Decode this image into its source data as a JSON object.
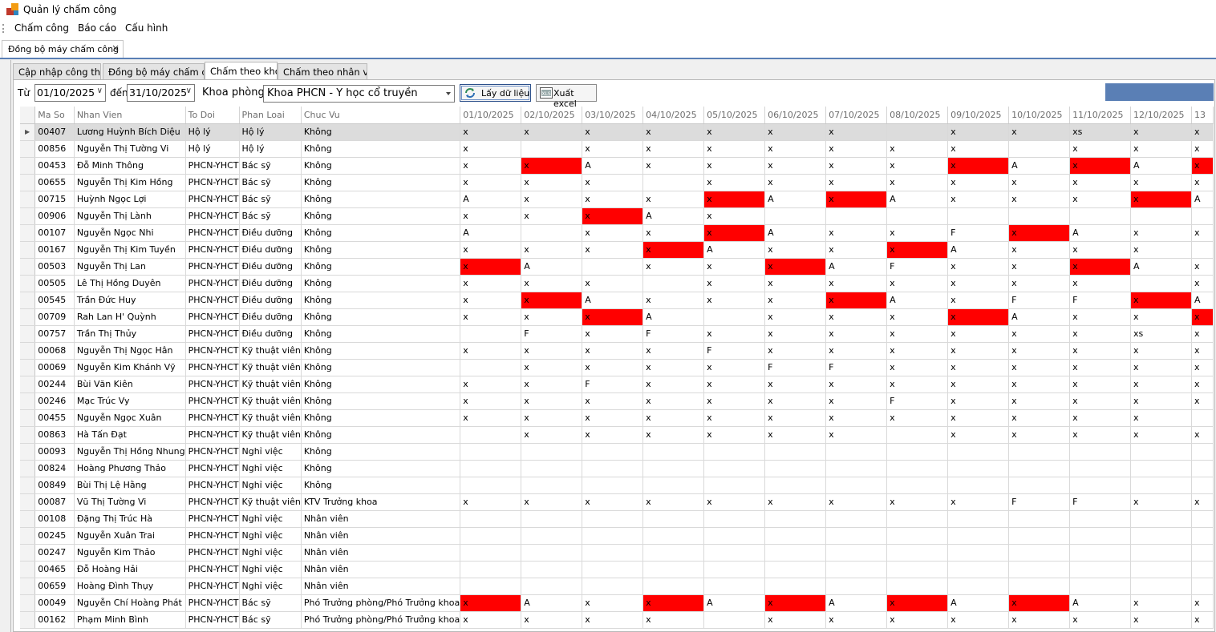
{
  "window": {
    "title": "Quản lý chấm công"
  },
  "menu": [
    "Chấm công",
    "Báo cáo",
    "Cấu hình"
  ],
  "doc_tab": {
    "label": "Đồng bộ máy chấm công",
    "close": "×"
  },
  "sub_tabs": [
    "Cập nhập công thức",
    "Đồng bộ máy chấm công",
    "Chấm theo khoa",
    "Chấm theo nhân viên"
  ],
  "filters": {
    "from_label": "Từ",
    "from_value": "01/10/2025",
    "to_label": "đến",
    "to_value": "31/10/2025",
    "dept_label": "Khoa phòng",
    "dept_value": "Khoa PHCN - Y học cổ truyền",
    "fetch_button": "Lấy dữ liệu",
    "export_button": "Xuất excel"
  },
  "colors": {
    "absent_highlight": "#ff0000",
    "accent": "#5a7fb5"
  },
  "grid": {
    "columns": [
      "Ma So",
      "Nhan Vien",
      "To Doi",
      "Phan Loai",
      "Chuc Vu",
      "01/10/2025",
      "02/10/2025",
      "03/10/2025",
      "04/10/2025",
      "05/10/2025",
      "06/10/2025",
      "07/10/2025",
      "08/10/2025",
      "09/10/2025",
      "10/10/2025",
      "11/10/2025",
      "12/10/2025",
      "13"
    ],
    "rows": [
      {
        "id": "00407",
        "name": "Lương Huỳnh Bích Diệu",
        "team": "Hộ lý",
        "type": "Hộ lý",
        "role": "Không",
        "days": [
          "x",
          "x",
          "x",
          "x",
          "x",
          "x",
          "x",
          "",
          "x",
          "x",
          "xs",
          "x",
          "x"
        ],
        "red": []
      },
      {
        "id": "00856",
        "name": "Nguyễn Thị Tường Vi",
        "team": "Hộ lý",
        "type": "Hộ lý",
        "role": "Không",
        "days": [
          "x",
          "",
          "x",
          "x",
          "x",
          "x",
          "x",
          "x",
          "x",
          "",
          "x",
          "x",
          "x"
        ],
        "red": []
      },
      {
        "id": "00453",
        "name": "Đỗ Minh Thông",
        "team": "PHCN-YHCT",
        "type": "Bác sỹ",
        "role": "Không",
        "days": [
          "x",
          "x",
          "A",
          "x",
          "x",
          "x",
          "x",
          "x",
          "x",
          "A",
          "x",
          "A",
          "x"
        ],
        "red": [
          1,
          8,
          10,
          12
        ]
      },
      {
        "id": "00655",
        "name": "Nguyễn Thị Kim Hồng",
        "team": "PHCN-YHCT",
        "type": "Bác sỹ",
        "role": "Không",
        "days": [
          "x",
          "x",
          "x",
          "",
          "x",
          "x",
          "x",
          "x",
          "x",
          "x",
          "x",
          "x",
          "x"
        ],
        "red": []
      },
      {
        "id": "00715",
        "name": "Huỳnh Ngọc Lợi",
        "team": "PHCN-YHCT",
        "type": "Bác sỹ",
        "role": "Không",
        "days": [
          "A",
          "x",
          "x",
          "x",
          "x",
          "A",
          "x",
          "A",
          "x",
          "x",
          "x",
          "x",
          "A"
        ],
        "red": [
          4,
          6,
          11
        ]
      },
      {
        "id": "00906",
        "name": "Nguyễn Thị Lành",
        "team": "PHCN-YHCT",
        "type": "Bác sỹ",
        "role": "Không",
        "days": [
          "x",
          "x",
          "x",
          "A",
          "x",
          "",
          "",
          "",
          "",
          "",
          "",
          "",
          ""
        ],
        "red": [
          2
        ]
      },
      {
        "id": "00107",
        "name": "Nguyễn Ngọc Nhi",
        "team": "PHCN-YHCT",
        "type": "Điều dưỡng",
        "role": "Không",
        "days": [
          "A",
          "",
          "x",
          "x",
          "x",
          "A",
          "x",
          "x",
          "F",
          "x",
          "A",
          "x",
          "x"
        ],
        "red": [
          4,
          9
        ]
      },
      {
        "id": "00167",
        "name": "Nguyễn Thị Kim Tuyền",
        "team": "PHCN-YHCT",
        "type": "Điều dưỡng",
        "role": "Không",
        "days": [
          "x",
          "x",
          "x",
          "x",
          "A",
          "x",
          "x",
          "x",
          "A",
          "x",
          "x",
          "x",
          ""
        ],
        "red": [
          3,
          7
        ]
      },
      {
        "id": "00503",
        "name": "Nguyễn Thị Lan",
        "team": "PHCN-YHCT",
        "type": "Điều dưỡng",
        "role": "Không",
        "days": [
          "x",
          "A",
          "",
          "x",
          "x",
          "x",
          "A",
          "F",
          "x",
          "x",
          "x",
          "A",
          "x"
        ],
        "red": [
          0,
          5,
          10
        ]
      },
      {
        "id": "00505",
        "name": "Lê Thị Hồng Duyên",
        "team": "PHCN-YHCT",
        "type": "Điều dưỡng",
        "role": "Không",
        "days": [
          "x",
          "x",
          "x",
          "",
          "x",
          "x",
          "x",
          "x",
          "x",
          "x",
          "x",
          "",
          "x"
        ],
        "red": []
      },
      {
        "id": "00545",
        "name": "Trần Đức Huy",
        "team": "PHCN-YHCT",
        "type": "Điều dưỡng",
        "role": "Không",
        "days": [
          "x",
          "x",
          "A",
          "x",
          "x",
          "x",
          "x",
          "A",
          "x",
          "F",
          "F",
          "x",
          "A"
        ],
        "red": [
          1,
          6,
          11
        ]
      },
      {
        "id": "00709",
        "name": "Rah Lan H' Quỳnh",
        "team": "PHCN-YHCT",
        "type": "Điều dưỡng",
        "role": "Không",
        "days": [
          "x",
          "x",
          "x",
          "A",
          "",
          "x",
          "x",
          "x",
          "x",
          "A",
          "x",
          "x",
          "x"
        ],
        "red": [
          2,
          8,
          12
        ]
      },
      {
        "id": "00757",
        "name": "Trần Thị Thủy",
        "team": "PHCN-YHCT",
        "type": "Điều dưỡng",
        "role": "Không",
        "days": [
          "",
          "F",
          "x",
          "F",
          "x",
          "x",
          "x",
          "x",
          "x",
          "x",
          "x",
          "xs",
          "x"
        ],
        "red": []
      },
      {
        "id": "00068",
        "name": "Nguyễn Thị Ngọc Hân",
        "team": "PHCN-YHCT",
        "type": "Kỹ thuật viên",
        "role": "Không",
        "days": [
          "x",
          "x",
          "x",
          "x",
          "F",
          "x",
          "x",
          "x",
          "x",
          "x",
          "x",
          "x",
          "x"
        ],
        "red": []
      },
      {
        "id": "00069",
        "name": "Nguyễn Kim Khánh Vỹ",
        "team": "PHCN-YHCT",
        "type": "Kỹ thuật viên",
        "role": "Không",
        "days": [
          "",
          "x",
          "x",
          "x",
          "x",
          "F",
          "F",
          "x",
          "x",
          "x",
          "x",
          "x",
          "x"
        ],
        "red": []
      },
      {
        "id": "00244",
        "name": "Bùi Văn Kiên",
        "team": "PHCN-YHCT",
        "type": "Kỹ thuật viên",
        "role": "Không",
        "days": [
          "x",
          "x",
          "F",
          "x",
          "x",
          "x",
          "x",
          "x",
          "x",
          "x",
          "x",
          "x",
          "x"
        ],
        "red": []
      },
      {
        "id": "00246",
        "name": "Mạc Trúc Vy",
        "team": "PHCN-YHCT",
        "type": "Kỹ thuật viên",
        "role": "Không",
        "days": [
          "x",
          "x",
          "x",
          "x",
          "x",
          "x",
          "x",
          "F",
          "x",
          "x",
          "x",
          "x",
          "x"
        ],
        "red": []
      },
      {
        "id": "00455",
        "name": "Nguyễn Ngọc Xuân",
        "team": "PHCN-YHCT",
        "type": "Kỹ thuật viên",
        "role": "Không",
        "days": [
          "x",
          "x",
          "x",
          "x",
          "x",
          "x",
          "x",
          "x",
          "x",
          "x",
          "x",
          "x",
          ""
        ],
        "red": []
      },
      {
        "id": "00863",
        "name": "Hà Tấn Đạt",
        "team": "PHCN-YHCT",
        "type": "Kỹ thuật viên",
        "role": "Không",
        "days": [
          "",
          "x",
          "x",
          "x",
          "x",
          "x",
          "x",
          "",
          "x",
          "x",
          "x",
          "x",
          "x"
        ],
        "red": []
      },
      {
        "id": "00093",
        "name": "Nguyễn Thị Hồng Nhung",
        "team": "PHCN-YHCT",
        "type": "Nghỉ việc",
        "role": "Không",
        "days": [
          "",
          "",
          "",
          "",
          "",
          "",
          "",
          "",
          "",
          "",
          "",
          "",
          ""
        ],
        "red": []
      },
      {
        "id": "00824",
        "name": "Hoàng Phương Thảo",
        "team": "PHCN-YHCT",
        "type": "Nghỉ việc",
        "role": "Không",
        "days": [
          "",
          "",
          "",
          "",
          "",
          "",
          "",
          "",
          "",
          "",
          "",
          "",
          ""
        ],
        "red": []
      },
      {
        "id": "00849",
        "name": "Bùi Thị Lệ Hằng",
        "team": "PHCN-YHCT",
        "type": "Nghỉ việc",
        "role": "Không",
        "days": [
          "",
          "",
          "",
          "",
          "",
          "",
          "",
          "",
          "",
          "",
          "",
          "",
          ""
        ],
        "red": []
      },
      {
        "id": "00087",
        "name": "Vũ Thị Tường Vi",
        "team": "PHCN-YHCT",
        "type": "Kỹ thuật viên",
        "role": "KTV Trưởng khoa",
        "days": [
          "x",
          "x",
          "x",
          "x",
          "x",
          "x",
          "x",
          "x",
          "x",
          "F",
          "F",
          "x",
          "x"
        ],
        "red": []
      },
      {
        "id": "00108",
        "name": "Đặng Thị Trúc Hà",
        "team": "PHCN-YHCT",
        "type": "Nghỉ việc",
        "role": "Nhân viên",
        "days": [
          "",
          "",
          "",
          "",
          "",
          "",
          "",
          "",
          "",
          "",
          "",
          "",
          ""
        ],
        "red": []
      },
      {
        "id": "00245",
        "name": "Nguyễn Xuân Trai",
        "team": "PHCN-YHCT",
        "type": "Nghỉ việc",
        "role": "Nhân viên",
        "days": [
          "",
          "",
          "",
          "",
          "",
          "",
          "",
          "",
          "",
          "",
          "",
          "",
          ""
        ],
        "red": []
      },
      {
        "id": "00247",
        "name": "Nguyễn Kim Thảo",
        "team": "PHCN-YHCT",
        "type": "Nghỉ việc",
        "role": "Nhân viên",
        "days": [
          "",
          "",
          "",
          "",
          "",
          "",
          "",
          "",
          "",
          "",
          "",
          "",
          ""
        ],
        "red": []
      },
      {
        "id": "00465",
        "name": "Đỗ Hoàng Hải",
        "team": "PHCN-YHCT",
        "type": "Nghỉ việc",
        "role": "Nhân viên",
        "days": [
          "",
          "",
          "",
          "",
          "",
          "",
          "",
          "",
          "",
          "",
          "",
          "",
          ""
        ],
        "red": []
      },
      {
        "id": "00659",
        "name": "Hoàng Đình Thụy",
        "team": "PHCN-YHCT",
        "type": "Nghỉ việc",
        "role": "Nhân viên",
        "days": [
          "",
          "",
          "",
          "",
          "",
          "",
          "",
          "",
          "",
          "",
          "",
          "",
          ""
        ],
        "red": []
      },
      {
        "id": "00049",
        "name": "Nguyễn Chí Hoàng Phát",
        "team": "PHCN-YHCT",
        "type": "Bác sỹ",
        "role": "Phó Trưởng phòng/Phó Trưởng khoa",
        "days": [
          "x",
          "A",
          "x",
          "x",
          "A",
          "x",
          "A",
          "x",
          "A",
          "x",
          "A",
          "x",
          "x"
        ],
        "red": [
          0,
          3,
          5,
          7,
          9
        ]
      },
      {
        "id": "00162",
        "name": "Phạm Minh Bình",
        "team": "PHCN-YHCT",
        "type": "Bác sỹ",
        "role": "Phó Trưởng phòng/Phó Trưởng khoa",
        "days": [
          "x",
          "x",
          "x",
          "x",
          "",
          "x",
          "x",
          "x",
          "x",
          "x",
          "x",
          "x",
          "x"
        ],
        "red": []
      }
    ]
  }
}
